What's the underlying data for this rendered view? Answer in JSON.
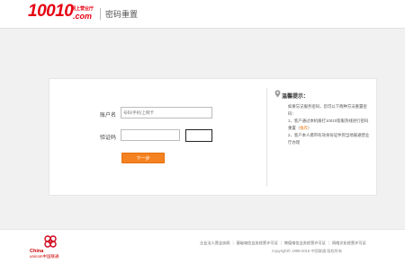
{
  "header": {
    "logo_number": "10010",
    "logo_tagline": "网上营业厅",
    "logo_domain": ".com",
    "page_title": "密码重置"
  },
  "form": {
    "account_label": "账户名",
    "account_placeholder": "号码/手机/上网卡",
    "captcha_label": "验证码",
    "captcha_placeholder": "",
    "next_button": "下一步"
  },
  "tips": {
    "title": "温馨提示：",
    "intro": "如果忘记服务密码，您可以下两种方法重置密码：",
    "item1_prefix": "1、客户通过本机拨打10010客服热线进行密码重置（",
    "item1_link": "推荐",
    "item1_suffix": "）",
    "item2": "2、客户本人携带有效身份证件到当地联通营业厅办理"
  },
  "footer": {
    "brand_cn": "China",
    "brand_en": "unicom中国联通",
    "links": [
      "企业法人营业执照",
      "基础电信业务经营许可证",
      "增值电信业务经营许可证",
      "网络文化经营许可证"
    ],
    "copyright": "Copyright© 1999-2016 中国联通 版权所有"
  },
  "colors": {
    "brand_red": "#e60012",
    "accent_orange": "#f58220"
  }
}
